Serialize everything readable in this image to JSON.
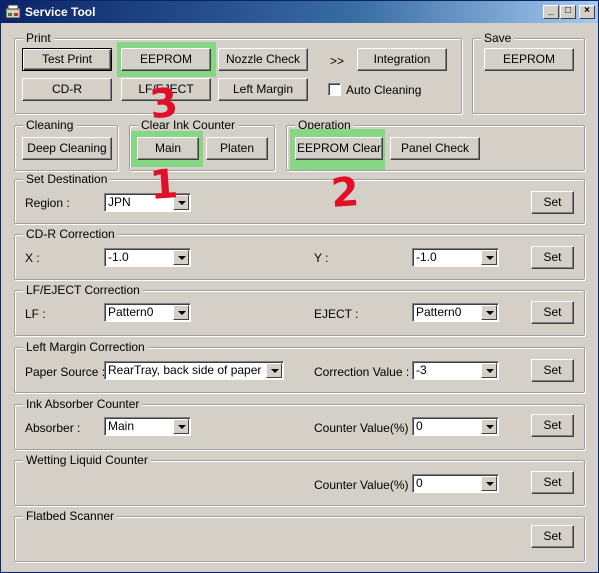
{
  "window": {
    "title": "Service Tool",
    "controls": {
      "minimize": "_",
      "maximize": "□",
      "close": "×"
    }
  },
  "print": {
    "legend": "Print",
    "test_print": "Test Print",
    "eeprom": "EEPROM",
    "nozzle_check": "Nozzle Check",
    "arrows": ">>",
    "integration": "Integration",
    "cd_r": "CD-R",
    "lf_eject": "LF/EJECT",
    "left_margin": "Left Margin",
    "auto_cleaning": "Auto Cleaning"
  },
  "save": {
    "legend": "Save",
    "eeprom": "EEPROM"
  },
  "cleaning": {
    "legend": "Cleaning",
    "deep_cleaning": "Deep Cleaning"
  },
  "clear_ink": {
    "legend": "Clear Ink Counter",
    "main": "Main",
    "platen": "Platen"
  },
  "operation": {
    "legend": "Operation",
    "eeprom_clear": "EEPROM Clear",
    "panel_check": "Panel Check"
  },
  "set_destination": {
    "legend": "Set Destination",
    "region_label": "Region :",
    "region_value": "JPN",
    "set": "Set"
  },
  "cdr_correction": {
    "legend": "CD-R Correction",
    "x_label": "X :",
    "x_value": "-1.0",
    "y_label": "Y :",
    "y_value": "-1.0",
    "set": "Set"
  },
  "lf_eject_correction": {
    "legend": "LF/EJECT Correction",
    "lf_label": "LF :",
    "lf_value": "Pattern0",
    "eject_label": "EJECT :",
    "eject_value": "Pattern0",
    "set": "Set"
  },
  "left_margin_correction": {
    "legend": "Left Margin Correction",
    "source_label": "Paper Source :",
    "source_value": "RearTray, back side of paper",
    "corr_label": "Correction Value :",
    "corr_value": "-3",
    "set": "Set"
  },
  "ink_absorber": {
    "legend": "Ink Absorber Counter",
    "absorber_label": "Absorber :",
    "absorber_value": "Main",
    "counter_label": "Counter Value(%) :",
    "counter_value": "0",
    "set": "Set"
  },
  "wetting_liquid": {
    "legend": "Wetting Liquid Counter",
    "counter_label": "Counter Value(%) :",
    "counter_value": "0",
    "set": "Set"
  },
  "flatbed": {
    "legend": "Flatbed Scanner",
    "set": "Set"
  },
  "annotations": {
    "step1": "1",
    "step2": "2",
    "step3": "3"
  },
  "colors": {
    "highlight": "#86d686",
    "annotation": "#e0102a",
    "titlebar": "#0a246a"
  }
}
